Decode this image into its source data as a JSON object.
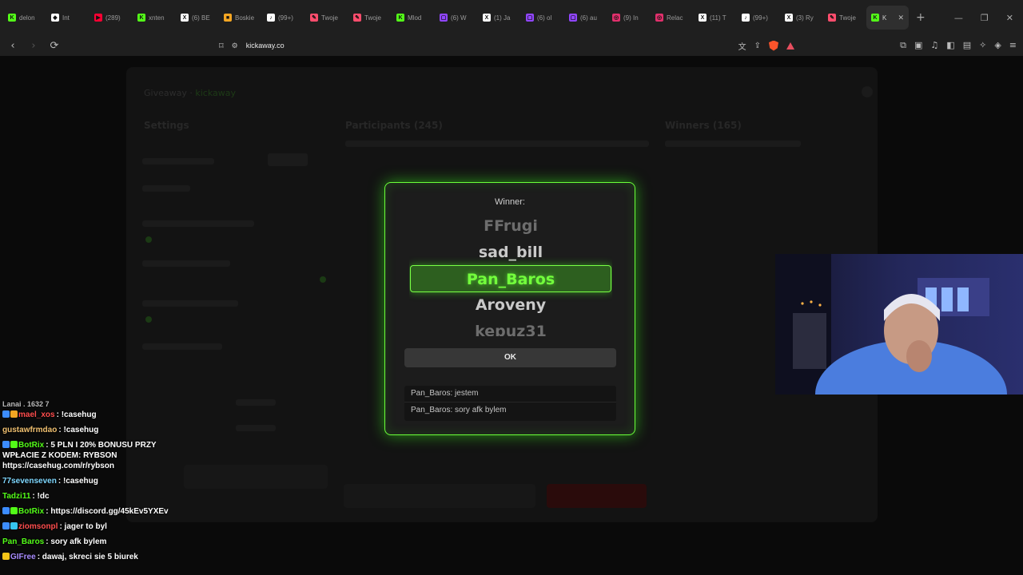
{
  "tabs": [
    {
      "label": "delon",
      "favicon": "kick-icon",
      "color": "#53fc18"
    },
    {
      "label": "Int",
      "favicon": "diamond-icon",
      "color": "#ffffff"
    },
    {
      "label": "(289)",
      "favicon": "youtube-icon",
      "color": "#ff0033"
    },
    {
      "label": "xnten",
      "favicon": "kick-icon",
      "color": "#53fc18"
    },
    {
      "label": "(6) BE",
      "favicon": "x-icon",
      "color": "#ffffff"
    },
    {
      "label": "Boskie",
      "favicon": "bookmark-icon",
      "color": "#f5a623"
    },
    {
      "label": "(99+)",
      "favicon": "tiktok-icon",
      "color": "#ffffff"
    },
    {
      "label": "Twoje",
      "favicon": "tool-icon",
      "color": "#ff4d6d"
    },
    {
      "label": "Twoje",
      "favicon": "tool-icon",
      "color": "#ff4d6d"
    },
    {
      "label": "Mlod",
      "favicon": "kick-icon",
      "color": "#53fc18"
    },
    {
      "label": "(6) W",
      "favicon": "twitch-icon",
      "color": "#9146ff"
    },
    {
      "label": "(1) Ja",
      "favicon": "x-icon",
      "color": "#ffffff"
    },
    {
      "label": "(6) ol",
      "favicon": "twitch-icon",
      "color": "#9146ff"
    },
    {
      "label": "(6) au",
      "favicon": "twitch-icon",
      "color": "#9146ff"
    },
    {
      "label": "(9) In",
      "favicon": "instagram-icon",
      "color": "#e1306c"
    },
    {
      "label": "Relac",
      "favicon": "instagram-icon",
      "color": "#e1306c"
    },
    {
      "label": "(11) T",
      "favicon": "x-icon",
      "color": "#ffffff"
    },
    {
      "label": "(99+)",
      "favicon": "tiktok-icon",
      "color": "#ffffff"
    },
    {
      "label": "(3) Ry",
      "favicon": "x-icon",
      "color": "#ffffff"
    },
    {
      "label": "Twoje",
      "favicon": "tool-icon",
      "color": "#ff4d6d"
    },
    {
      "label": "K",
      "favicon": "kickaway-icon",
      "color": "#53fc18",
      "active": true
    }
  ],
  "address_bar": {
    "url": "kickaway.co"
  },
  "background": {
    "header_left": "Giveaway",
    "header_brand": "kickaway",
    "col_settings": "Settings",
    "col_participants": "Participants (245)",
    "col_winners": "Winners (165)"
  },
  "modal": {
    "title": "Winner:",
    "roll_names": [
      "FFrugi",
      "sad_bill",
      "Pan_Baros",
      "Aroveny",
      "kepuz31"
    ],
    "selected_index": 2,
    "ok_label": "OK",
    "messages": [
      "Pan_Baros: jestem",
      "Pan_Baros: sory afk bylem"
    ]
  },
  "stream_chat": {
    "cut_top": "Lanai . 1632 7",
    "messages": [
      {
        "user": "mael_xos",
        "text": ": !casehug",
        "color": "#ff4d4d",
        "badges": [
          "#3c8cff",
          "#f5a623"
        ]
      },
      {
        "user": "gustawfrmdao",
        "text": ": !casehug",
        "color": "#f0c070",
        "badges": []
      },
      {
        "user": "BotRix",
        "text": ": 5 PLN I 20% BONUSU PRZY WPŁACIE Z KODEM: RYBSON https://casehug.com/r/rybson",
        "color": "#53fc18",
        "badges": [
          "#3c8cff",
          "#53fc18"
        ]
      },
      {
        "user": "77sevenseven",
        "text": ": !casehug",
        "color": "#7fd8ff",
        "badges": []
      },
      {
        "user": "Tadzi11",
        "text": ": !dc",
        "color": "#53fc18",
        "badges": []
      },
      {
        "user": "BotRix",
        "text": ": https://discord.gg/45kEv5YXEv",
        "color": "#53fc18",
        "badges": [
          "#3c8cff",
          "#53fc18"
        ]
      },
      {
        "user": "ziomsonpl",
        "text": ": jager to byl",
        "color": "#ff4d4d",
        "badges": [
          "#3c8cff",
          "#36c5f0"
        ]
      },
      {
        "user": "Pan_Baros",
        "text": ": sory afk bylem",
        "color": "#53fc18",
        "badges": []
      },
      {
        "user": "GIFree",
        "text": ": dawaj, skreci sie 5 biurek",
        "color": "#a88bff",
        "badges": [
          "#f5c518"
        ]
      }
    ]
  }
}
